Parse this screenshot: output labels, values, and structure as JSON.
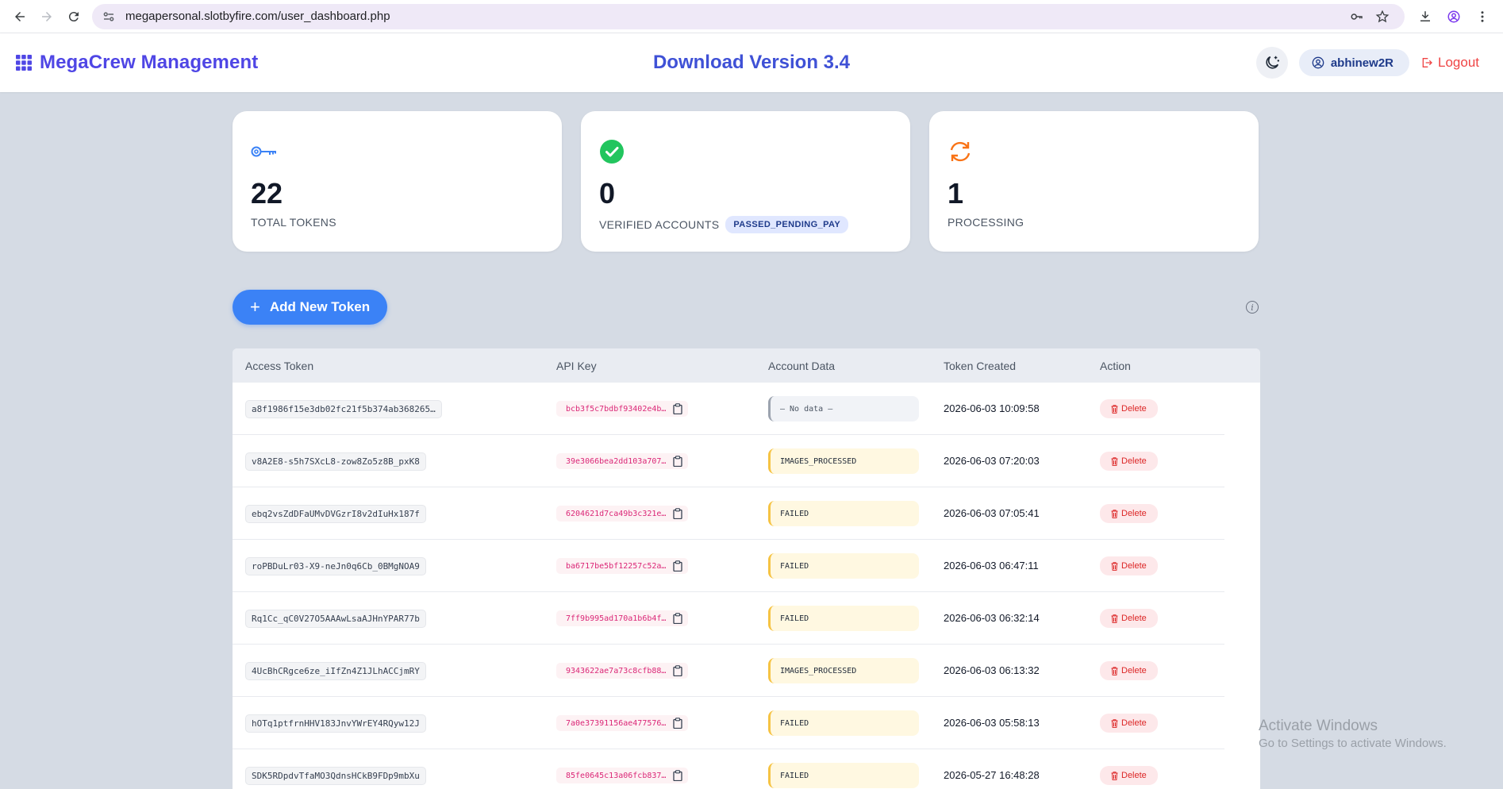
{
  "browser": {
    "url": "megapersonal.slotbyfire.com/user_dashboard.php"
  },
  "header": {
    "brand": "MegaCrew Management",
    "download_link": "Download Version 3.4",
    "username": "abhinew2R",
    "logout": "Logout"
  },
  "stats": [
    {
      "value": "22",
      "label": "TOTAL TOKENS",
      "icon": "key-icon",
      "color": "#3b82f6"
    },
    {
      "value": "0",
      "label": "VERIFIED ACCOUNTS",
      "badge": "PASSED_PENDING_PAY",
      "icon": "check-circle-icon",
      "color": "#22c55e"
    },
    {
      "value": "1",
      "label": "PROCESSING",
      "icon": "sync-icon",
      "color": "#f97316"
    }
  ],
  "actions": {
    "add_token": "Add New Token"
  },
  "table": {
    "headers": [
      "Access Token",
      "API Key",
      "Account Data",
      "Token Created",
      "Action"
    ],
    "delete_label": "Delete",
    "rows": [
      {
        "token": "a8f1986f15e3db02fc21f5b374ab368265…",
        "api": "bcb3f5c7bdbf93402e4b…",
        "account": "— No data —",
        "status": "none",
        "created": "2026-06-03 10:09:58"
      },
      {
        "token": "v8A2E8-s5h7SXcL8-zow8Zo5z8B_pxK8",
        "api": "39e3066bea2dd103a707…",
        "account": "IMAGES_PROCESSED",
        "status": "warn",
        "created": "2026-06-03 07:20:03"
      },
      {
        "token": "ebq2vsZdDFaUMvDVGzrI8v2dIuHx187f",
        "api": "6204621d7ca49b3c321e…",
        "account": "FAILED",
        "status": "warn",
        "created": "2026-06-03 07:05:41"
      },
      {
        "token": "roPBDuLr03-X9-neJn0q6Cb_0BMgNOA9",
        "api": "ba6717be5bf12257c52a…",
        "account": "FAILED",
        "status": "warn",
        "created": "2026-06-03 06:47:11"
      },
      {
        "token": "Rq1Cc_qC0V27O5AAAwLsaAJHnYPAR77b",
        "api": "7ff9b995ad170a1b6b4f…",
        "account": "FAILED",
        "status": "warn",
        "created": "2026-06-03 06:32:14"
      },
      {
        "token": "4UcBhCRgce6ze_iIfZn4Z1JLhACCjmRY",
        "api": "9343622ae7a73c8cfb88…",
        "account": "IMAGES_PROCESSED",
        "status": "warn",
        "created": "2026-06-03 06:13:32"
      },
      {
        "token": "hOTq1ptfrnHHV183JnvYWrEY4RQyw12J",
        "api": "7a0e37391156ae477576…",
        "account": "FAILED",
        "status": "warn",
        "created": "2026-06-03 05:58:13"
      },
      {
        "token": "SDK5RDpdvTfaMO3QdnsHCkB9FDp9mbXu",
        "api": "85fe0645c13a06fcb837…",
        "account": "FAILED",
        "status": "warn",
        "created": "2026-05-27 16:48:28"
      }
    ]
  },
  "watermark": {
    "line1": "Activate Windows",
    "line2": "Go to Settings to activate Windows."
  }
}
